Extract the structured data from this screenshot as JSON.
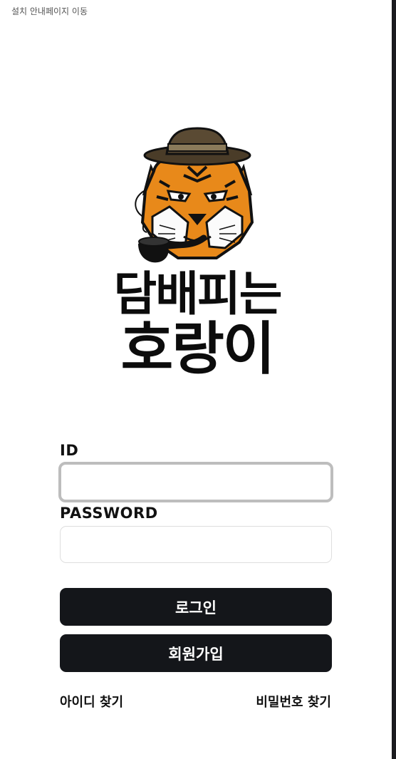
{
  "top_bar": {
    "install_link": "설치 안내페이지 이동"
  },
  "logo": {
    "mascot": "tiger-with-hat-and-pipe",
    "line1": "담배피는",
    "line2": "호랑이"
  },
  "form": {
    "id_label": "ID",
    "id_value": "",
    "password_label": "PASSWORD",
    "password_value": ""
  },
  "actions": {
    "login_label": "로그인",
    "signup_label": "회원가입"
  },
  "links": {
    "find_id": "아이디 찾기",
    "find_password": "비밀번호 찾기"
  },
  "colors": {
    "primary_button": "#14161a",
    "tiger_orange": "#e8891a",
    "hat_brown": "#5a4a33"
  }
}
